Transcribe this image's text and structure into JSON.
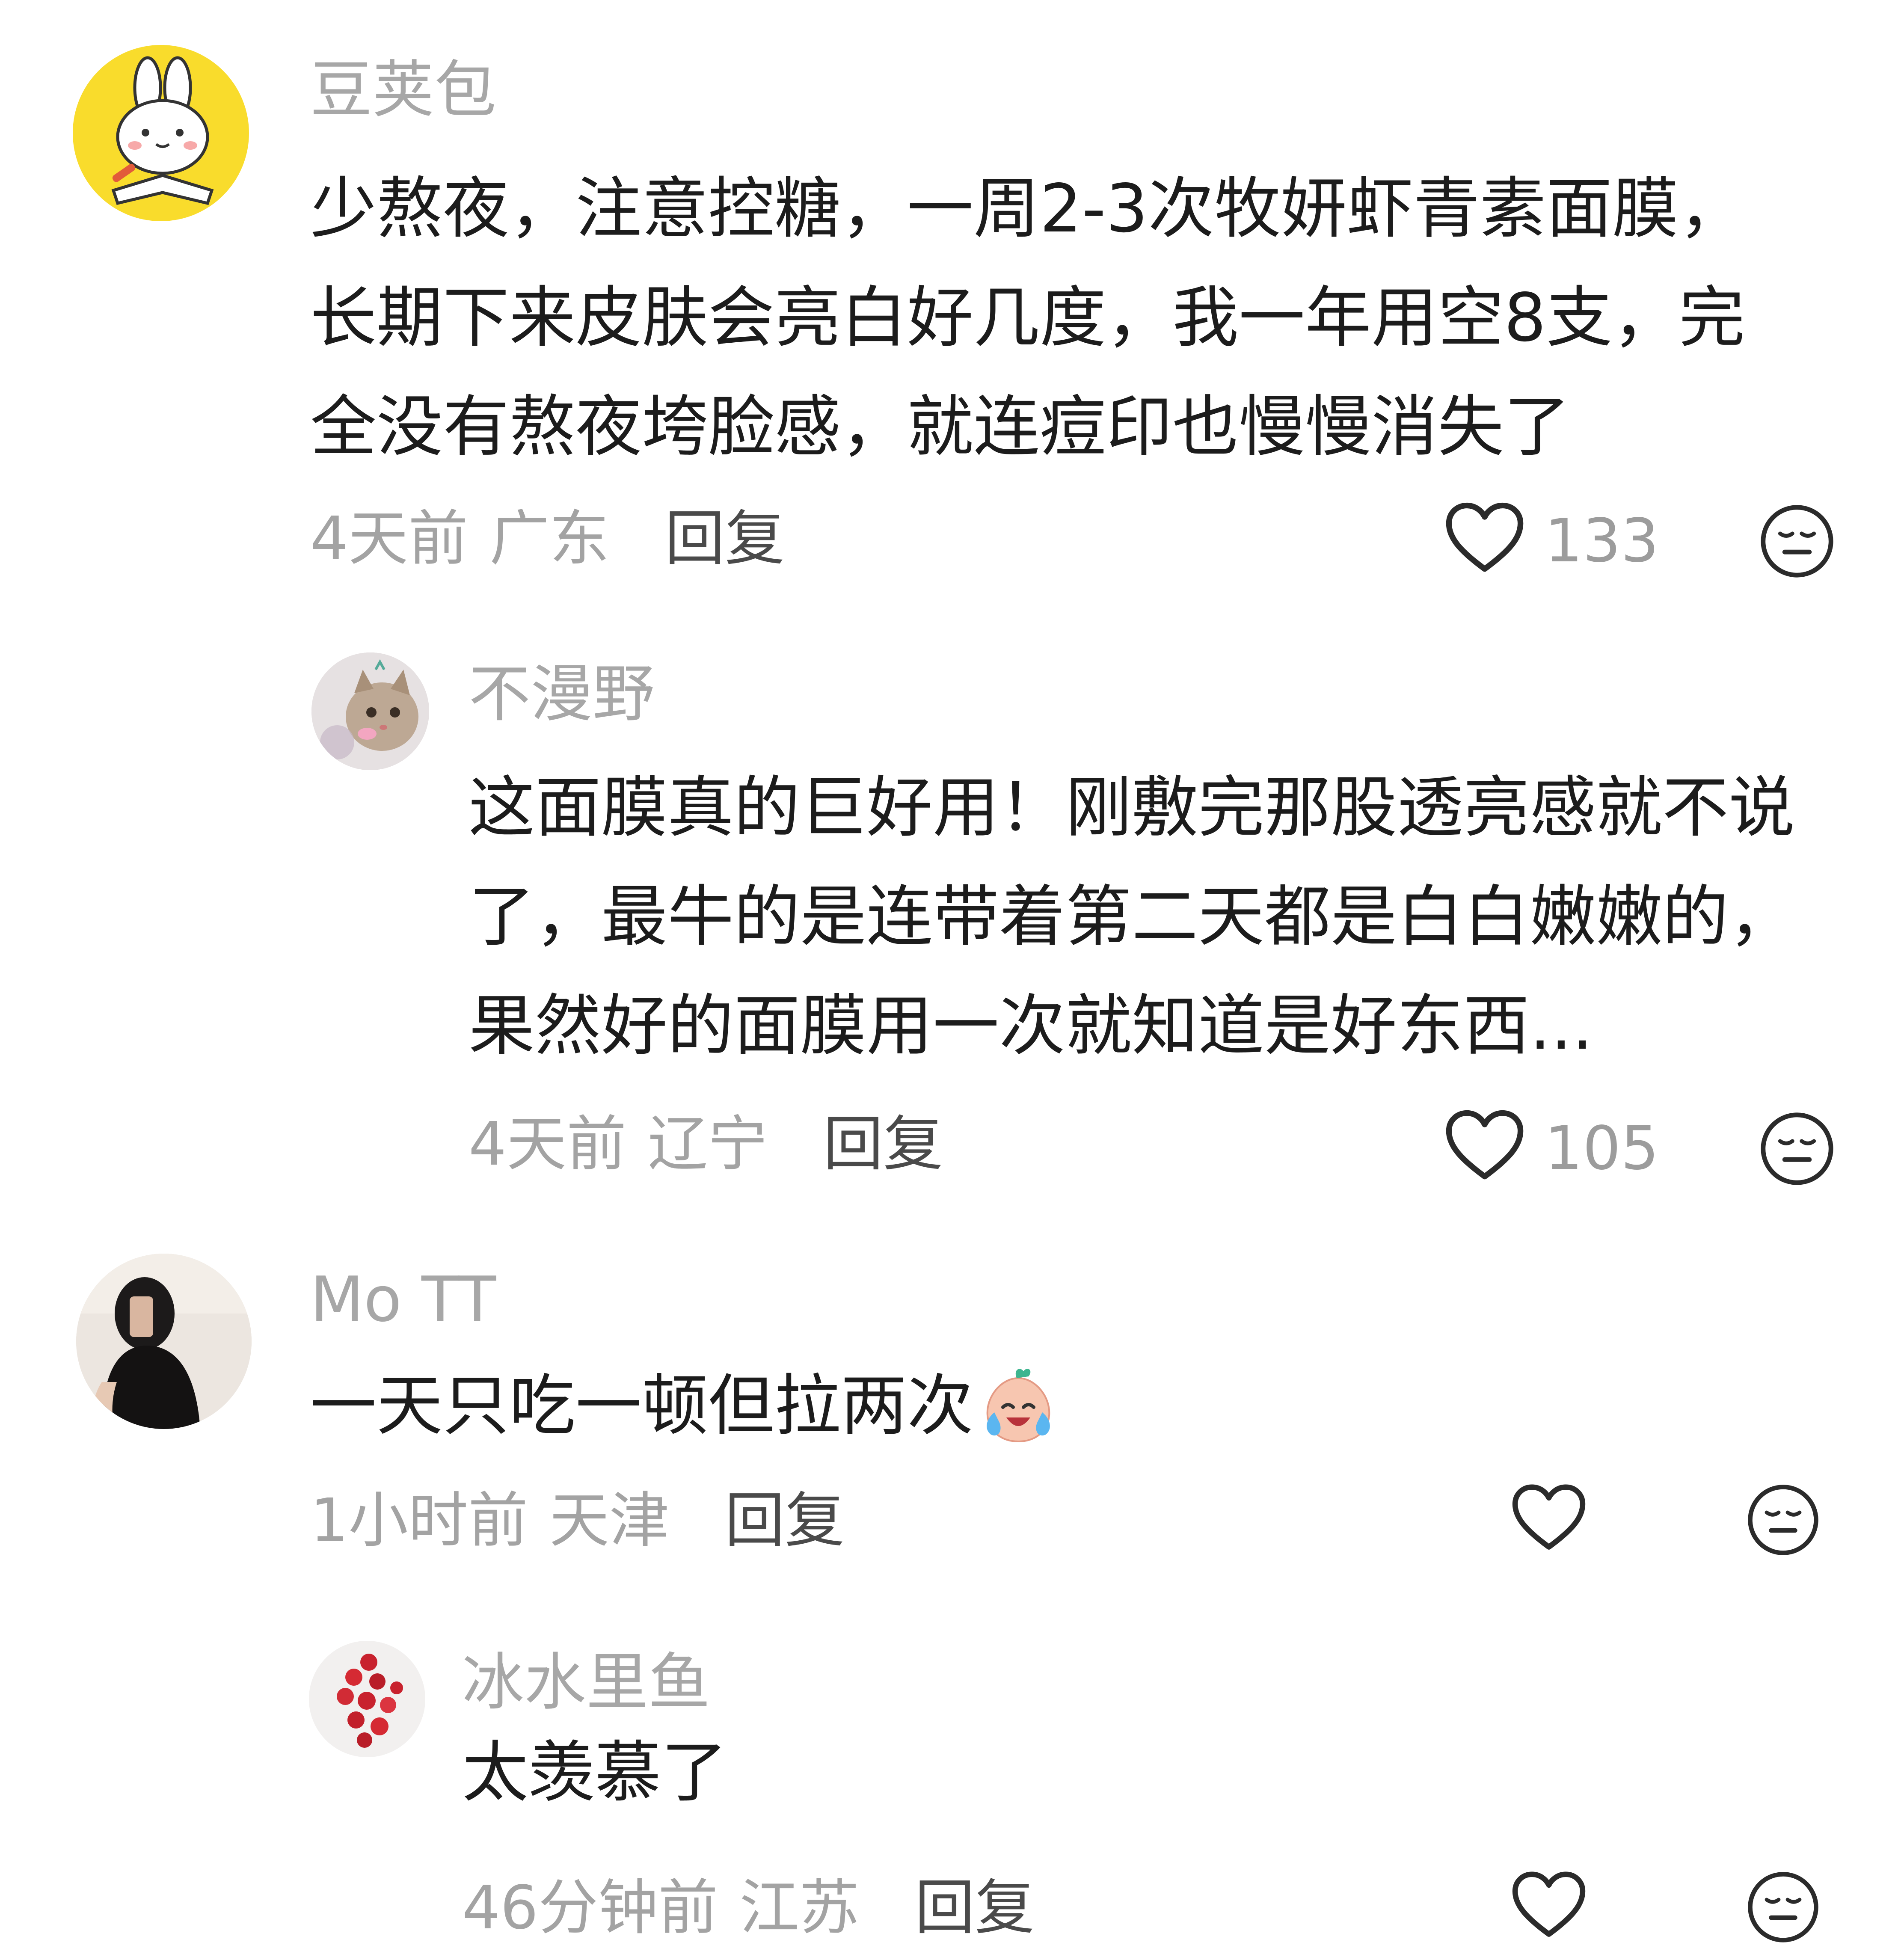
{
  "comments": [
    {
      "username": "豆荚包",
      "text": "少熬夜，注意控糖，一周2-3次牧妍虾青素面膜，长期下来皮肤会亮白好几度，我一年用空8支，完全没有熬夜垮脸感，就连痘印也慢慢消失了",
      "time": "4天前",
      "location": "广东",
      "reply_label": "回复",
      "likes": "133",
      "avatar_icon": "bunny-reading-avatar",
      "replies": [
        {
          "username": "不漫野",
          "text": "这面膜真的巨好用！刚敷完那股透亮感就不说了，最牛的是连带着第二天都是白白嫩嫩的，果然好的面膜用一次就知道是好东西...",
          "time": "4天前",
          "location": "辽宁",
          "reply_label": "回复",
          "likes": "105",
          "avatar_icon": "kitten-photo-avatar"
        }
      ]
    },
    {
      "username": "Mo TT",
      "text": "一天只吃一顿但拉两次",
      "emoji_icon": "crying-laughing-peach-emoji",
      "time": "1小时前",
      "location": "天津",
      "reply_label": "回复",
      "likes": "",
      "avatar_icon": "woman-selfie-avatar",
      "replies": [
        {
          "username": "冰水里鱼",
          "text": "太羡慕了",
          "time": "46分钟前",
          "location": "江苏",
          "reply_label": "回复",
          "likes": "",
          "avatar_icon": "strawberries-photo-avatar"
        }
      ]
    }
  ],
  "icons": {
    "like": "heart-outline-icon",
    "dislike": "meh-face-icon"
  },
  "colors": {
    "username": "#a7a7a7",
    "body_text": "#1c1c1c",
    "meta_text": "#a3a3a3",
    "reply_text": "#4a4a4a",
    "icon_stroke": "#2b2b2b",
    "avatar_yellow": "#f9dc2c"
  }
}
